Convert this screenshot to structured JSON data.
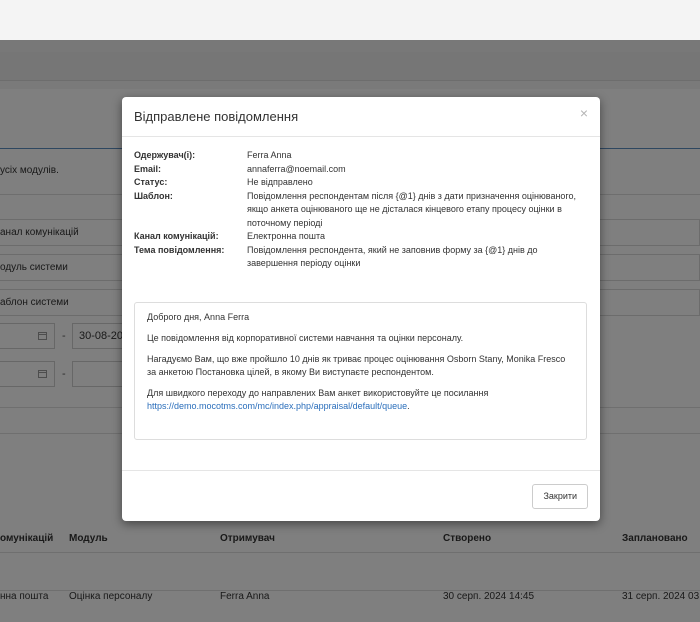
{
  "background": {
    "notice_text": "усіх модулів.",
    "filters": [
      {
        "label": "анал комунікацій"
      },
      {
        "label": "одуль системи"
      },
      {
        "label": "аблон системи"
      }
    ],
    "date_from_value": "30-08-20",
    "date_separator": "-",
    "table": {
      "headers": [
        "омунікацій",
        "Модуль",
        "Отримувач",
        "Створено",
        "Заплановано"
      ],
      "row": [
        "нна пошта",
        "Оцінка персоналу",
        "Ferra Anna",
        "30 серп. 2024 14:45",
        "31 серп. 2024 03"
      ]
    }
  },
  "modal": {
    "title": "Відправлене повідомлення",
    "close_icon": "×",
    "fields": [
      {
        "label": "Одержувач(і):",
        "value": "Ferra Anna"
      },
      {
        "label": "Email:",
        "value": "annaferra@noemail.com"
      },
      {
        "label": "Статус:",
        "value": "Не відправлено"
      },
      {
        "label": "Шаблон:",
        "value": "Повідомлення респондентам після {@1} днів з дати призначення оцінюваного, якщо анкета оцінюваного ще не дісталася кінцевого етапу процесу оцінки в поточному періоді"
      },
      {
        "label": "Канал комунікацій:",
        "value": "Електронна пошта"
      },
      {
        "label": "Тема повідомлення:",
        "value": "Повідомлення респондента, який не заповнив форму за {@1} днів до завершення періоду оцінки"
      }
    ],
    "message": {
      "greeting": "Доброго дня, Anna Ferra",
      "line1": "Це повідомлення від корпоративної системи навчання та оцінки персоналу.",
      "line2": "Нагадуємо Вам, що вже пройшло 10 днів як триває процес оцінювання Osborn Stany, Monika Fresco за анкетою Постановка цілей, в якому Ви виступаєте респондентом.",
      "line3": "Для швидкого переходу до направлених Вам анкет використовуйте це посилання",
      "link": "https://demo.mocotms.com/mc/index.php/appraisal/default/queue",
      "link_suffix": "."
    },
    "close_button": "Закрити"
  }
}
